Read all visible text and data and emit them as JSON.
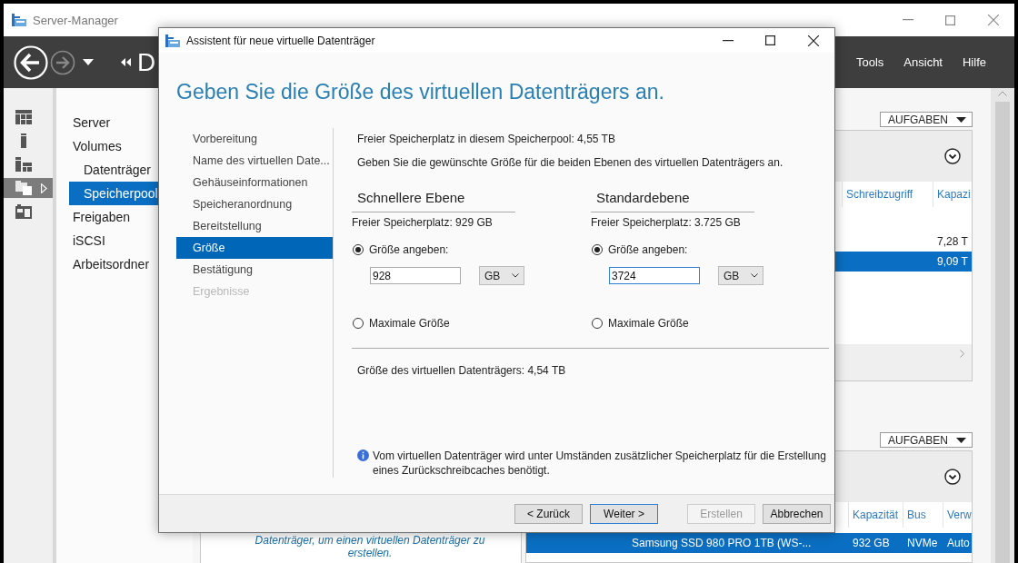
{
  "app": {
    "title": "Server-Manager",
    "breadcrumb": "D",
    "menu": [
      "Tools",
      "Ansicht",
      "Hilfe"
    ]
  },
  "icon_strip": [
    {
      "kind": "dashboard",
      "selected": false
    },
    {
      "kind": "server",
      "selected": false
    },
    {
      "kind": "servers",
      "selected": false
    },
    {
      "kind": "files",
      "selected": true
    },
    {
      "kind": "tools",
      "selected": false
    }
  ],
  "nav": [
    {
      "label": "Server",
      "selected": false
    },
    {
      "label": "Volumes",
      "selected": false,
      "children": [
        {
          "label": "Datenträger",
          "selected": false
        },
        {
          "label": "Speicherpool",
          "selected": true
        }
      ]
    },
    {
      "label": "Freigaben",
      "selected": false
    },
    {
      "label": "iSCSI",
      "selected": false
    },
    {
      "label": "Arbeitsordner",
      "selected": false
    }
  ],
  "pools_panel": {
    "task_button": "AUFGABEN",
    "columns": [
      "Schreibzugriff",
      "Kapazi"
    ],
    "rows": [
      {
        "capacity": "7,28 T",
        "selected": false
      },
      {
        "capacity": "9,09 T",
        "selected": true
      }
    ]
  },
  "disks_panel": {
    "task_button": "AUFGABEN",
    "hint": "Datenträger, um einen virtuellen Datenträger zu erstellen.",
    "columns": [
      "Kapazität",
      "Bus",
      "Verw"
    ],
    "rows": [
      {
        "name": "Samsung SSD 980 PRO 1TB (WS-...",
        "capacity": "932 GB",
        "bus": "NVMe",
        "column_4": "Auto",
        "selected": true
      }
    ]
  },
  "wizard": {
    "title": "Assistent für neue virtuelle Datenträger",
    "heading": "Geben Sie die Größe des virtuellen Datenträgers an.",
    "steps": [
      {
        "label": "Vorbereitung",
        "selected": false,
        "disabled": false
      },
      {
        "label": "Name des virtuellen Date...",
        "selected": false,
        "disabled": false
      },
      {
        "label": "Gehäuseinformationen",
        "selected": false,
        "disabled": false
      },
      {
        "label": "Speicheranordnung",
        "selected": false,
        "disabled": false
      },
      {
        "label": "Bereitstellung",
        "selected": false,
        "disabled": false
      },
      {
        "label": "Größe",
        "selected": true,
        "disabled": false
      },
      {
        "label": "Bestätigung",
        "selected": false,
        "disabled": false
      },
      {
        "label": "Ergebnisse",
        "selected": false,
        "disabled": true
      }
    ],
    "pool_free": "Freier Speicherplatz in diesem Speicherpool: 4,55 TB",
    "instruction": "Geben Sie die gewünschte Größe für die beiden Ebenen des virtuellen Datenträgers an.",
    "tiers": [
      {
        "name": "Schnellere Ebene",
        "free": "Freier Speicherplatz: 929 GB",
        "options": [
          {
            "label": "Größe angeben:",
            "selected": true
          },
          {
            "label": "Maximale Größe",
            "selected": false
          }
        ],
        "value": "928",
        "focused": false,
        "unit": "GB"
      },
      {
        "name": "Standardebene",
        "free": "Freier Speicherplatz: 3.725 GB",
        "options": [
          {
            "label": "Größe angeben:",
            "selected": true
          },
          {
            "label": "Maximale Größe",
            "selected": false
          }
        ],
        "value": "3724",
        "focused": true,
        "unit": "GB"
      }
    ],
    "total": "Größe des virtuellen Datenträgers: 4,54 TB",
    "info": "Vom virtuellen Datenträger wird unter Umständen zusätzlicher Speicherplatz für die Erstellung eines Zurückschreibcaches benötigt.",
    "buttons": [
      {
        "label": "< Zurück",
        "disabled": false,
        "default": false
      },
      {
        "label": "Weiter >",
        "disabled": false,
        "default": true
      },
      {
        "label": "Erstellen",
        "disabled": true,
        "default": false
      },
      {
        "label": "Abbrechen",
        "disabled": false,
        "default": false
      }
    ]
  }
}
